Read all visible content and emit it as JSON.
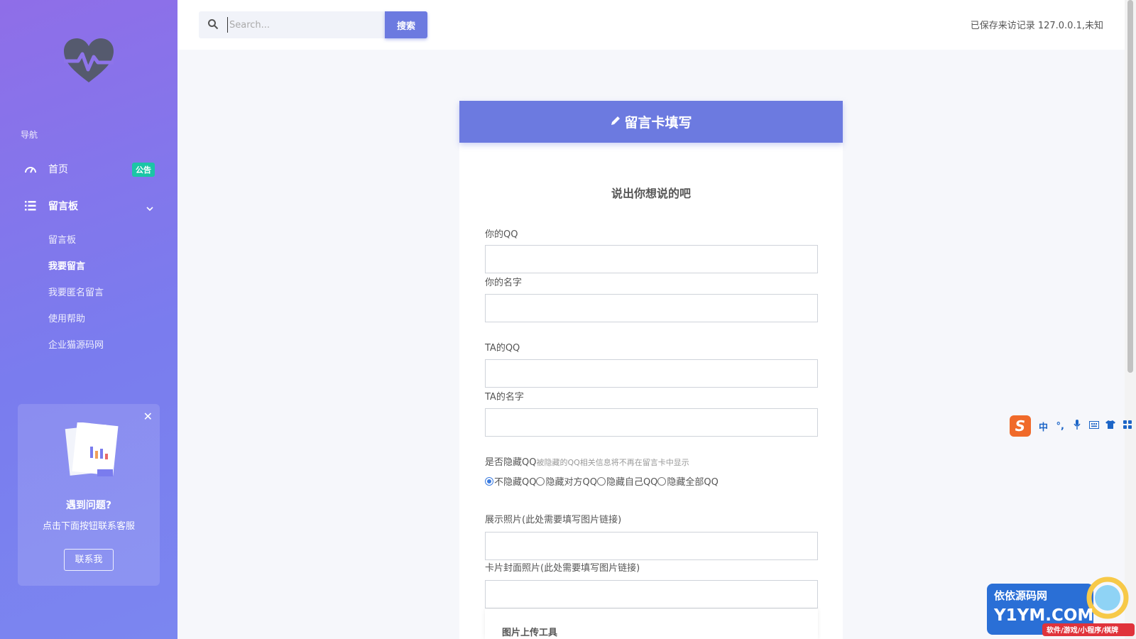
{
  "sidebar": {
    "logo_icon": "heartbeat-icon",
    "nav_title": "导航",
    "items": [
      {
        "label": "首页",
        "icon": "dashboard-icon",
        "badge": "公告"
      },
      {
        "label": "留言板",
        "icon": "list-icon"
      }
    ],
    "sub_items": [
      {
        "label": "留言板"
      },
      {
        "label": "我要留言"
      },
      {
        "label": "我要匿名留言"
      },
      {
        "label": "使用帮助"
      },
      {
        "label": "企业猫源码网"
      }
    ],
    "help": {
      "title": "遇到问题?",
      "text": "点击下面按钮联系客服",
      "button": "联系我"
    }
  },
  "topbar": {
    "search_placeholder": "Search...",
    "search_button": "搜索",
    "visitor_text": "已保存来访记录 127.0.0.1,未知"
  },
  "form": {
    "header": "留言卡填写",
    "title": "说出你想说的吧",
    "fields": {
      "your_qq": "你的QQ",
      "your_name": "你的名字",
      "ta_qq": "TA的QQ",
      "ta_name": "TA的名字",
      "hide_label": "是否隐藏QQ",
      "hide_hint": "被隐藏的QQ相关信息将不再在留言卡中显示",
      "photo": "展示照片(此处需要填写图片链接)",
      "cover": "卡片封面照片(此处需要填写图片链接)",
      "upload": "图片上传工具"
    },
    "radio_options": [
      "不隐藏QQ",
      "隐藏对方QQ",
      "隐藏自己QQ",
      "隐藏全部QQ"
    ],
    "radio_selected": "不隐藏QQ"
  },
  "ime": {
    "items": [
      "中",
      "°,",
      "mic-icon",
      "keyboard-icon",
      "shirt-icon",
      "grid-icon"
    ]
  },
  "watermark": {
    "line1": "依依源码网",
    "line2": "Y1YM.COM",
    "line3": "软件/游戏/小程序/棋牌"
  },
  "colors": {
    "accent": "#6c7ae0",
    "sidebar_top": "#8f6ee8",
    "sidebar_bottom": "#7b86f0",
    "badge": "#1bc5a6"
  }
}
